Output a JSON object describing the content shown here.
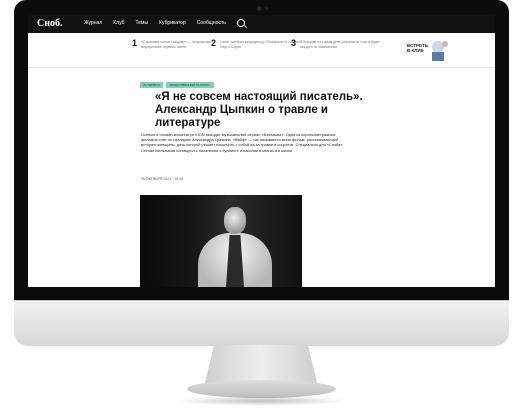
{
  "site": {
    "logo": "Сноб.",
    "nav": [
      "Журнал",
      "Клуб",
      "Темы",
      "Кубрикатор",
      "Сообщность"
    ]
  },
  "trending": [
    {
      "num": "1",
      "text": "«Страховка нынче каждому» — популярные медицинские сервисы осени"
    },
    {
      "num": "2",
      "text": "Сенат одобрил кандидатуру Обоимского и сложил спор о Сирии"
    },
    {
      "num": "3",
      "text": "В Кордове на самом деле разрешили снос и будет каждого не замеченная"
    }
  ],
  "promo": {
    "text": "ВСТРЕТЬ\nВ КЛУБ"
  },
  "article": {
    "tags": [
      "Интервью",
      "Общественный интерес"
    ],
    "title": "«Я не совсем настоящий писатель». Александр Цыпкин о травле и литературе",
    "lead": "Осенью в онлайн-кинотеатре KION выходит музыкальный сериал «Бэклашка». Одна из короткометражных фильмов снят по сценарию Александра Цыпкина. «Кайф» — так называется мини-фильм, рассказывающий историю женщины, дочь которой решает покончить с собой из-за травли в соцсетях. Специально для «Сноба» Степан Мельников поговорил с писателем о буллинге и насилии в книгах и в жизни",
    "date": "25 ОКТЯБРЯ 2021 · 15:25"
  },
  "colors": {
    "tag_bg": "#7fd0b9",
    "topbar_bg": "#111111",
    "bezel": "#0c0c0c"
  }
}
